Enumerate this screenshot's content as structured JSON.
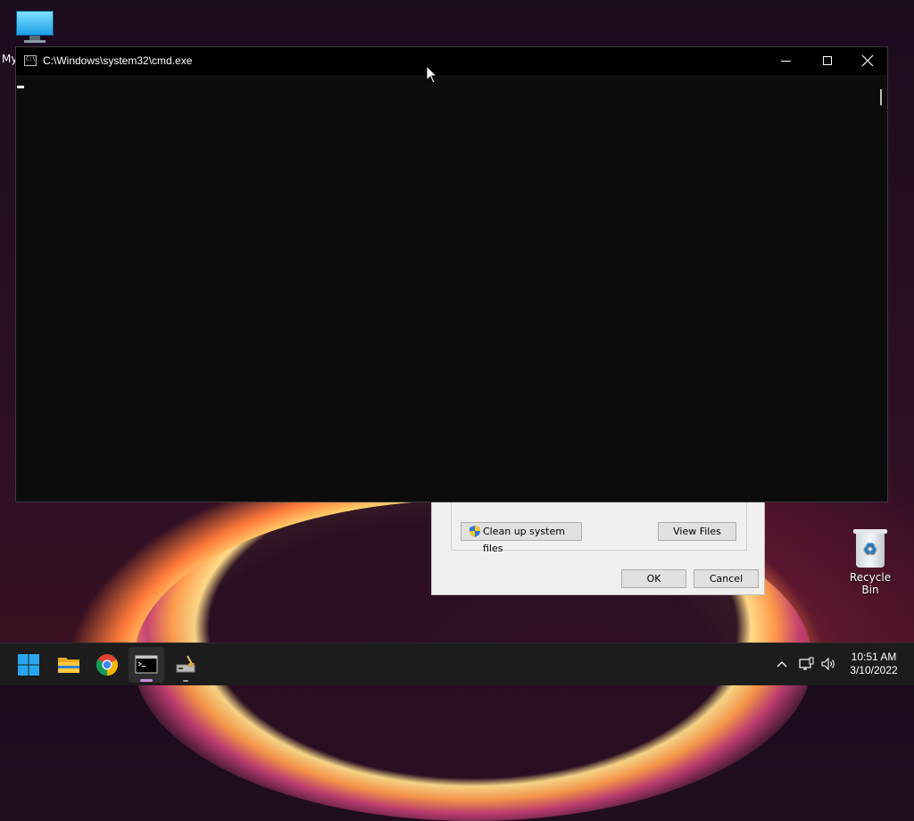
{
  "desktop": {
    "my_label": "My",
    "recycle_bin_label": "Recycle Bin"
  },
  "cmd_window": {
    "title": "C:\\Windows\\system32\\cmd.exe",
    "icon_text": "C:\\"
  },
  "cleanup_dialog": {
    "cleanup_system_files_label": "Clean up system files",
    "view_files_label": "View Files",
    "ok_label": "OK",
    "cancel_label": "Cancel"
  },
  "taskbar": {
    "items": [
      "start-button",
      "file-explorer",
      "chrome",
      "command-prompt",
      "disk-cleanup"
    ],
    "active_item": "command-prompt"
  },
  "clock": {
    "time": "10:51 AM",
    "date": "3/10/2022"
  },
  "colors": {
    "console_bg": "#0c0c0c",
    "taskbar_bg": "#1c1c1c",
    "active_indicator": "#c98ee0"
  }
}
